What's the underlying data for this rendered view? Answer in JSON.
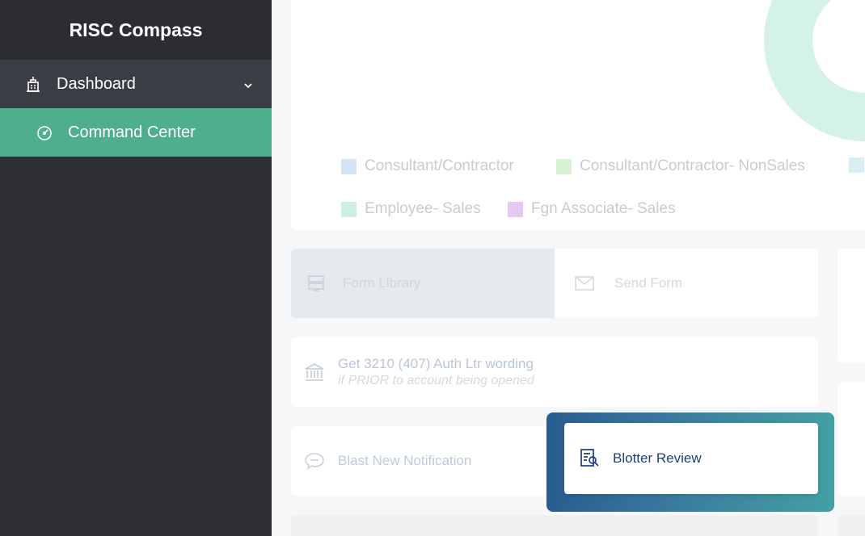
{
  "sidebar": {
    "brand": "RISC Compass",
    "items": [
      {
        "label": "Dashboard",
        "icon": "building-icon",
        "expanded": true
      },
      {
        "label": "Command Center",
        "icon": "speedometer-icon",
        "active": true
      }
    ]
  },
  "chart": {
    "legend": [
      {
        "label": "Consultant/Contractor",
        "color": "#d4e4f4"
      },
      {
        "label": "Consultant/Contractor- NonSales",
        "color": "#d6f2d2"
      },
      {
        "label": "Employee- Sales",
        "color": "#cdefe2"
      },
      {
        "label": "Fgn Associate- Sales",
        "color": "#e6c9f0"
      }
    ],
    "donut_colors": [
      "#d5f2e6",
      "#dfe1ea"
    ]
  },
  "tiles": {
    "form_library": "Form Library",
    "send_form": "Send Form",
    "auth_ltr_title": "Get 3210 (407) Auth Ltr wording",
    "auth_ltr_subtitle": "if PRIOR to account being opened",
    "blast_notification": "Blast New Notification",
    "blotter_review": "Blotter Review"
  },
  "colors": {
    "sidebar_bg": "#2e3036",
    "active_item": "#4fae8c",
    "highlight_start": "#2a5c8f",
    "highlight_end": "#43a0a2",
    "blotter_text": "#1f3f7a"
  }
}
